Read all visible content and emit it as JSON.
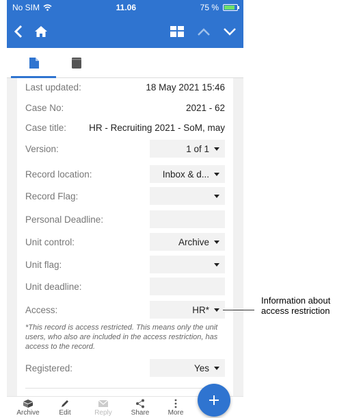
{
  "status": {
    "carrier": "No SIM",
    "time": "11.06",
    "battery": "75 %"
  },
  "nav": {
    "back_icon": "chevron-left-icon",
    "home_icon": "home-icon",
    "view_icon": "layout-icon",
    "prev_icon": "chevron-up-icon",
    "next_icon": "chevron-down-icon"
  },
  "tabs": [
    {
      "icon": "document-icon",
      "active": true
    },
    {
      "icon": "book-icon",
      "active": false
    }
  ],
  "fields": {
    "last_updated": {
      "label": "Last updated:",
      "value": "18 May 2021 15:46"
    },
    "case_no": {
      "label": "Case No:",
      "value": "2021 - 62"
    },
    "case_title": {
      "label": "Case title:",
      "value": "HR - Recruiting 2021 - SoM, may"
    },
    "version": {
      "label": "Version:",
      "value": "1 of 1"
    },
    "record_location": {
      "label": "Record location:",
      "value": "Inbox & d..."
    },
    "record_flag": {
      "label": "Record Flag:",
      "value": ""
    },
    "personal_deadline": {
      "label": "Personal Deadline:",
      "value": ""
    },
    "unit_control": {
      "label": "Unit control:",
      "value": "Archive"
    },
    "unit_flag": {
      "label": "Unit flag:",
      "value": ""
    },
    "unit_deadline": {
      "label": "Unit deadline:",
      "value": ""
    },
    "access": {
      "label": "Access:",
      "value": "HR*"
    },
    "access_note": "*This record is access restricted. This means only the unit users, who also are included in the access restriction, has access to the record.",
    "registered": {
      "label": "Registered:",
      "value": "Yes"
    }
  },
  "bottombar": {
    "archive": "Archive",
    "edit": "Edit",
    "reply": "Reply",
    "share": "Share",
    "more": "More"
  },
  "callout": {
    "line1": "Information about",
    "line2": "access restriction"
  },
  "colors": {
    "accent": "#2f74d0",
    "background": "#f1f1f1"
  }
}
